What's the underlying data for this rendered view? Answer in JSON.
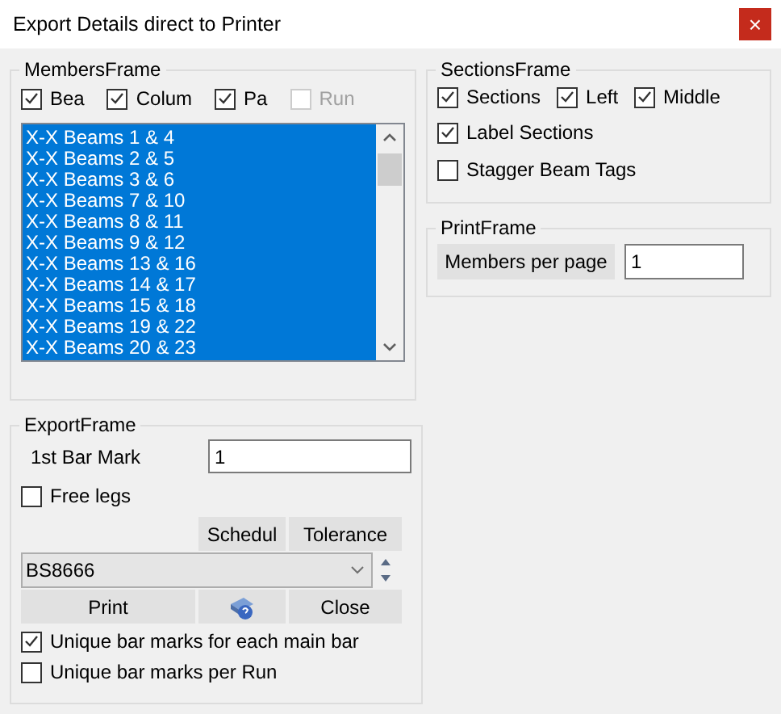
{
  "window": {
    "title": "Export Details direct to Printer",
    "close": "×"
  },
  "members_frame": {
    "title": "MembersFrame",
    "checkboxes": [
      {
        "label": "Bea",
        "checked": true,
        "disabled": false
      },
      {
        "label": "Colum",
        "checked": true,
        "disabled": false
      },
      {
        "label": "Pa",
        "checked": true,
        "disabled": false
      },
      {
        "label": "Run",
        "checked": false,
        "disabled": true
      }
    ],
    "list": [
      {
        "label": "X-X Beams 1 & 4",
        "selected": true
      },
      {
        "label": "X-X Beams 2 & 5",
        "selected": true
      },
      {
        "label": "X-X Beams 3 & 6",
        "selected": true
      },
      {
        "label": "X-X Beams 7 & 10",
        "selected": true
      },
      {
        "label": "X-X Beams 8 & 11",
        "selected": true
      },
      {
        "label": "X-X Beams 9 & 12",
        "selected": true
      },
      {
        "label": "X-X Beams 13 & 16",
        "selected": true
      },
      {
        "label": "X-X Beams 14 & 17",
        "selected": true
      },
      {
        "label": "X-X Beams 15 & 18",
        "selected": true
      },
      {
        "label": "X-X Beams 19 & 22",
        "selected": true
      },
      {
        "label": "X-X Beams 20 & 23",
        "selected": true
      }
    ]
  },
  "export_frame": {
    "title": "ExportFrame",
    "bar_mark_label": "1st Bar Mark",
    "bar_mark_value": "1",
    "free_legs": {
      "label": "Free legs",
      "checked": false
    },
    "schedule_button": "Schedul",
    "tolerance_button": "Tolerance",
    "standard": "BS8666",
    "print_button": "Print",
    "close_button": "Close",
    "options": [
      {
        "label": "Unique bar marks for each main bar",
        "checked": true
      },
      {
        "label": "Unique bar marks per Run",
        "checked": false
      }
    ]
  },
  "sections_frame": {
    "title": "SectionsFrame",
    "checkboxes": [
      {
        "label": "Sections",
        "checked": true
      },
      {
        "label": "Left",
        "checked": true
      },
      {
        "label": "Middle",
        "checked": true
      },
      {
        "label": "Label Sections",
        "checked": true
      },
      {
        "label": "Stagger Beam Tags",
        "checked": false
      }
    ]
  },
  "print_frame": {
    "title": "PrintFrame",
    "members_button": "Members per page",
    "members_value": "1"
  }
}
